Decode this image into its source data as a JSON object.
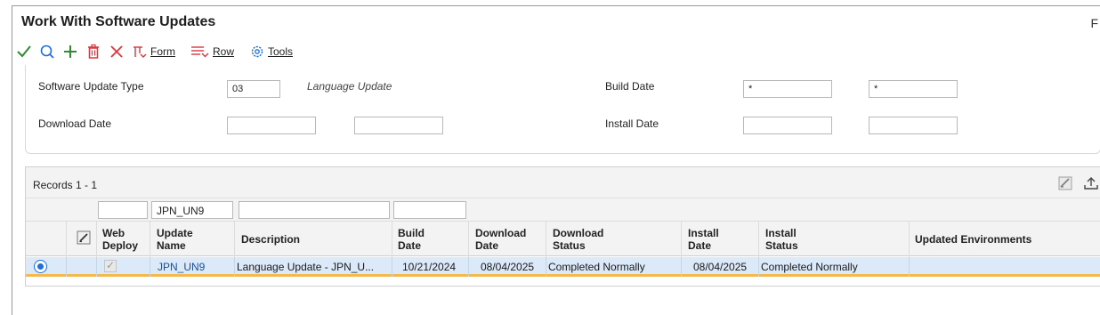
{
  "window": {
    "title": "Work With Software Updates",
    "edge_text": "F"
  },
  "toolbar": {
    "ok_icon": "checkmark-icon",
    "find_icon": "search-icon",
    "add_icon": "plus-icon",
    "delete_icon": "trash-icon",
    "close_icon": "close-icon",
    "form_label": "Form",
    "row_label": "Row",
    "tools_label": "Tools"
  },
  "criteria": {
    "software_update_type_label": "Software Update Type",
    "software_update_type_value": "03",
    "software_update_type_desc": "Language Update",
    "build_date_label": "Build Date",
    "build_date_from": "*",
    "build_date_to": "*",
    "download_date_label": "Download Date",
    "download_date_from": "",
    "download_date_to": "",
    "install_date_label": "Install Date",
    "install_date_from": "",
    "install_date_to": ""
  },
  "grid": {
    "records_label": "Records 1 - 1",
    "qbe": {
      "update_name": "JPN_UN9",
      "description": ""
    },
    "columns": {
      "web_deploy": "Web Deploy",
      "update_name": "Update Name",
      "description": "Description",
      "build_date": "Build Date",
      "download_date": "Download Date",
      "download_status": "Download Status",
      "install_date": "Install Date",
      "install_status": "Install Status",
      "updated_environments": "Updated Environments"
    },
    "rows": [
      {
        "web_deploy_checked": true,
        "update_name": "JPN_UN9",
        "description": "Language Update - JPN_U...",
        "build_date": "10/21/2024",
        "download_date": "08/04/2025",
        "download_status": "Completed Normally",
        "install_date": "08/04/2025",
        "install_status": "Completed Normally",
        "updated_environments": ""
      }
    ]
  },
  "colors": {
    "accent": "#1e6fd9",
    "selected_row": "#dbe9f8",
    "row_underline": "#f5b84a",
    "ok_green": "#2e8b2e",
    "delete_red": "#d9363e"
  }
}
